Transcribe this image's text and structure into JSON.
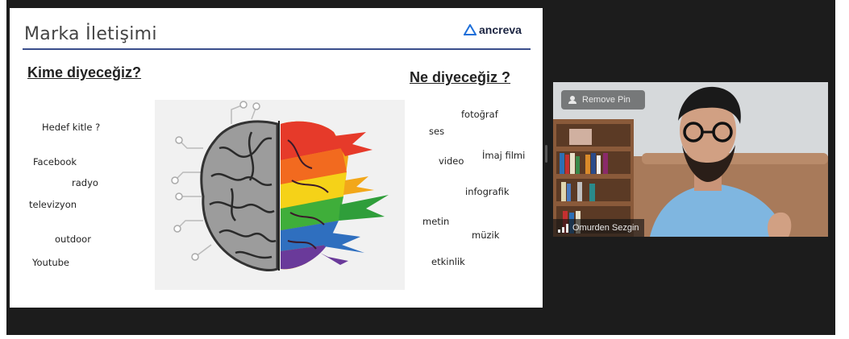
{
  "slide": {
    "title": "Marka İletişimi",
    "logo_text": "ancreva",
    "left_heading": "Kime diyeceğiz?",
    "right_heading": "Ne diyeceğiz ?",
    "left_words": [
      "Hedef kitle ?",
      "Facebook",
      "radyo",
      "televizyon",
      "outdoor",
      "Youtube"
    ],
    "right_words": [
      "fotoğraf",
      "ses",
      "video",
      "İmaj filmi",
      "infografik",
      "metin",
      "müzik",
      "etkinlik"
    ]
  },
  "participant": {
    "name": "Omurden Sezgin",
    "pin_label": "Remove Pin"
  },
  "colors": {
    "accent_rule": "#3a4e8c",
    "background": "#1c1c1c"
  }
}
